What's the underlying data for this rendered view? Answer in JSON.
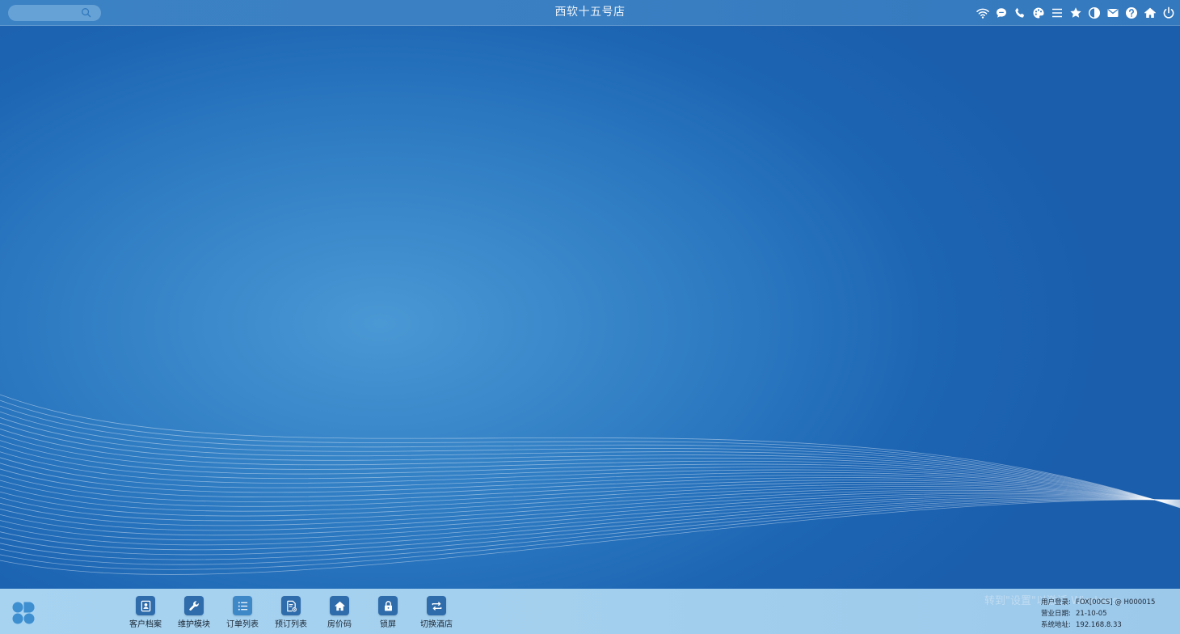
{
  "window": {
    "title": "西软十五号店"
  },
  "search": {
    "placeholder": "",
    "icon": "search-icon"
  },
  "top_icons": [
    "wifi-icon",
    "chat-icon",
    "phone-icon",
    "palette-icon",
    "menu-icon",
    "star-icon",
    "theme-icon",
    "mail-icon",
    "help-icon",
    "home-icon",
    "power-icon"
  ],
  "dock": {
    "items": [
      {
        "label": "客户档案",
        "icon": "customer-profile-icon"
      },
      {
        "label": "维护模块",
        "icon": "wrench-icon"
      },
      {
        "label": "订单列表",
        "icon": "list-icon"
      },
      {
        "label": "预订列表",
        "icon": "booking-icon"
      },
      {
        "label": "房价码",
        "icon": "house-icon"
      },
      {
        "label": "锁屏",
        "icon": "lock-icon"
      },
      {
        "label": "切换酒店",
        "icon": "switch-icon"
      }
    ]
  },
  "watermark": {
    "text": "转到\"设置\"以激活 Windows。"
  },
  "status": {
    "user_label": "用户登录:",
    "user_value": "FOX[00CS] @ H000015",
    "date_label": "营业日期:",
    "date_value": "21-10-05",
    "addr_label": "系统地址:",
    "addr_value": "192.168.8.33"
  },
  "colors": {
    "desktop": "#2f7cc3",
    "topbar": "#3a7fc2",
    "taskbar": "#a3cfee",
    "dock_icon_bg": "#2f6cab"
  }
}
